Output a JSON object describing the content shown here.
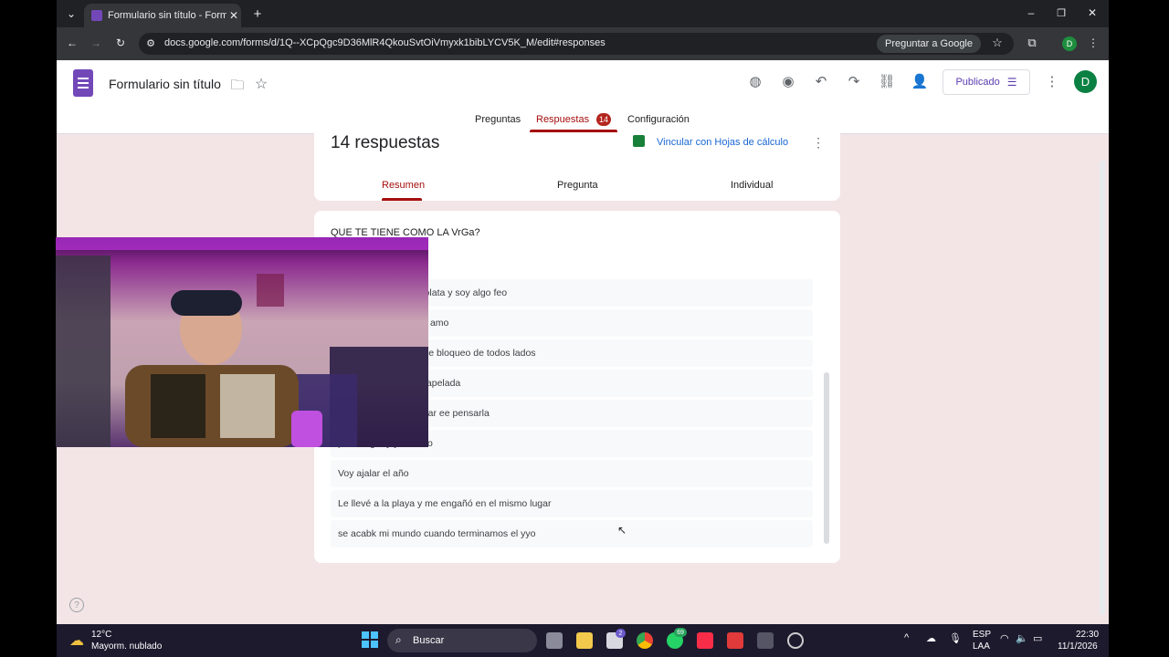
{
  "browser": {
    "tab_title": "Formulario sin título - Formulario",
    "url": "docs.google.com/forms/d/1Q--XCpQgc9D36MlR4QkouSvtOiVmyxk1bibLYCV5K_M/edit#responses",
    "ask_google": "Preguntar a Google",
    "profile_initial": "D"
  },
  "header": {
    "form_title": "Formulario sin título",
    "publish_label": "Publicado",
    "avatar_initial": "D"
  },
  "nav": {
    "tabs": [
      {
        "label": "Preguntas"
      },
      {
        "label": "Respuestas",
        "badge": "14"
      },
      {
        "label": "Configuración"
      }
    ]
  },
  "summary": {
    "count_label": "14 respuestas",
    "link_sheets": "Vincular con Hojas de cálculo",
    "subtabs": [
      "Resumen",
      "Pregunta",
      "Individual"
    ]
  },
  "question": {
    "title": "QUE TE TIENE COMO LA VrGa?",
    "answers": [
      "er novia si no tengo plata y soy algo feo",
      "le alejamiento y yo la amo",
      "le que la amo si ya me bloqueo de todos lados",
      "er para hablarle a unapelada",
      "extraño no puedo dejar ee pensarla",
      "para coger y yo leamo",
      "Voy ajalar el año",
      "Le llevé a la playa y me engañó en el mismo lugar",
      "se acabk mi mundo cuando terminamos el yyo"
    ]
  },
  "taskbar": {
    "weather_temp": "12°C",
    "weather_desc": "Mayorm. nublado",
    "search_label": "Buscar",
    "lang_top": "ESP",
    "lang_bottom": "LAA",
    "time": "22:30",
    "date": "11/1/2026",
    "badge_a": "2",
    "badge_b": "69"
  },
  "colors": {
    "forms_purple": "#7248b9",
    "accent_red": "#a50e0e",
    "page_bg": "#f3e5e6"
  }
}
